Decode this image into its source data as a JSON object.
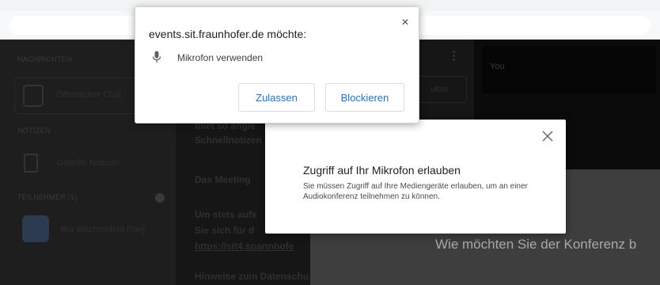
{
  "permission_prompt": {
    "origin_title": "events.sit.fraunhofer.de möchte:",
    "permission_icon": "microphone-icon",
    "permission_text": "Mikrofon verwenden",
    "allow_label": "Zulassen",
    "block_label": "Blockieren",
    "close_glyph": "×"
  },
  "notice_dialog": {
    "title": "Zugriff auf Ihr Mikrofon erlauben",
    "text": "Sie müssen Zugriff auf Ihre Mediengeräte erlauben, um an einer Audiokonferenz teilnehmen zu können."
  },
  "background": {
    "sidebar": {
      "messages_label": "NACHRICHTEN",
      "public_chat_label": "Öffentlicher Chat",
      "notes_label": "NOTIZEN",
      "shared_notes_label": "Geteilte Notizen",
      "users_label": "TEILNEHMER (1)",
      "user_name": "Ilka Wachtenfeld (Sie)"
    },
    "chat": {
      "header_fragment": "ufon",
      "line1": "Inlet so angle",
      "line2": "Schnellnotizen",
      "line3": "Das Meeting",
      "line4": "Um stets aufs",
      "line5": "Sie sich für d",
      "link_fragment": "https://sit4.sparmhofe",
      "line6": "Hinweise zum Datenschu"
    },
    "video_label": "You",
    "join_title": "Wie möchten Sie der Konferenz b"
  },
  "colors": {
    "link_blue": "#1a73e8",
    "dim_background": "#1b1b1b"
  }
}
